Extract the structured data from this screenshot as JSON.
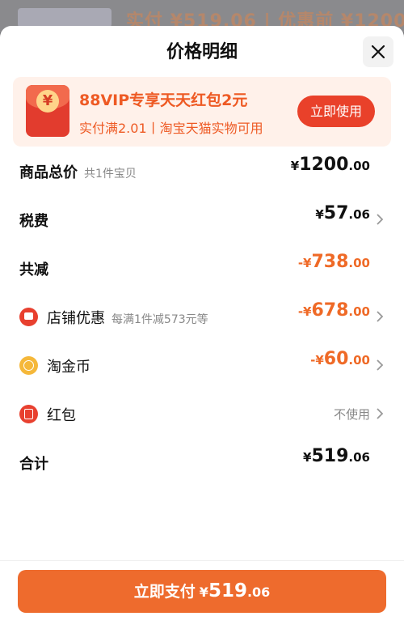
{
  "background_peek": {
    "text": "实付 ¥519.06 | 优惠前 ¥1200"
  },
  "sheet": {
    "title": "价格明细",
    "close_icon": "close-icon"
  },
  "banner": {
    "icon": "red-packet-icon",
    "icon_symbol": "¥",
    "title": "88VIP专享天天红包2元",
    "subtitle": "实付满2.01丨淘宝天猫实物可用",
    "button": "立即使用"
  },
  "rows": {
    "total": {
      "label": "商品总价",
      "hint": "共1件宝贝",
      "sym": "¥",
      "int": "1200",
      "dec": ".00"
    },
    "tax": {
      "label": "税费",
      "sym": "¥",
      "int": "57",
      "dec": ".06"
    },
    "discount": {
      "label": "共减",
      "sym": "-¥",
      "int": "738",
      "dec": ".00"
    },
    "store": {
      "label": "店铺优惠",
      "hint": "每满1件减573元等",
      "sym": "-¥",
      "int": "678",
      "dec": ".00",
      "icon": "store-icon"
    },
    "coin": {
      "label": "淘金币",
      "sym": "-¥",
      "int": "60",
      "dec": ".00",
      "icon": "coin-icon"
    },
    "redpacket": {
      "label": "红包",
      "value": "不使用",
      "icon": "red-envelope-icon"
    },
    "sum": {
      "label": "合计",
      "sym": "¥",
      "int": "519",
      "dec": ".06"
    }
  },
  "pay_button": {
    "label": "立即支付",
    "sym": "¥",
    "int": "519",
    "dec": ".06"
  },
  "colors": {
    "accent": "#ee6b2d",
    "banner_bg": "#fff1ea",
    "discount": "#ef6a27"
  }
}
